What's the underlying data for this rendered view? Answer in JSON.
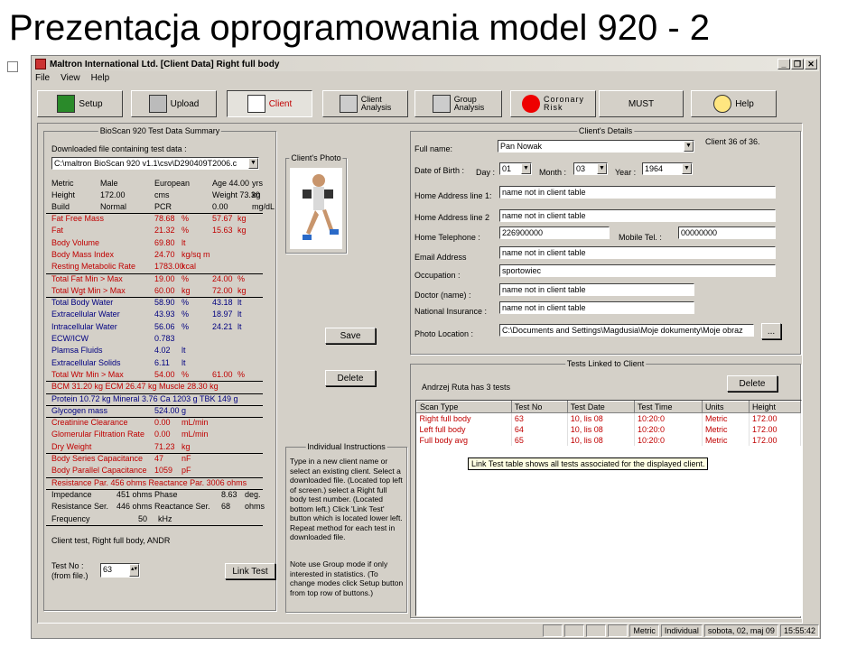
{
  "slide_title": "Prezentacja oprogramowania model 920 - 2",
  "window": {
    "title": "Maltron International Ltd.  [Client Data] Right full body",
    "btns": [
      "_",
      "❐",
      "✕"
    ]
  },
  "menu": [
    "File",
    "View",
    "Help"
  ],
  "toolbar": [
    {
      "label": "Setup",
      "icon": "setup-icon"
    },
    {
      "label": "Upload",
      "icon": "upload-icon"
    },
    {
      "label": "Client",
      "icon": "client-icon"
    },
    {
      "label": "Client\nAnalysis",
      "icon": "client-analysis-icon"
    },
    {
      "label": "Group\nAnalysis",
      "icon": "group-analysis-icon"
    },
    {
      "label": "Coronary\nRisk",
      "icon": "heart-icon"
    },
    {
      "label": "MUST",
      "icon": ""
    },
    {
      "label": "Help",
      "icon": "help-icon"
    }
  ],
  "bioscan": {
    "title": "BioScan 920 Test Data Summary",
    "downloaded_label": "Downloaded file containing  test data :",
    "file": "C:\\maltron BioScan 920 v1.1\\csv\\D290409T2006.c",
    "basic": [
      [
        "Metric",
        "Male",
        "European",
        "Age 44.00",
        "yrs"
      ],
      [
        "Height",
        "172.00",
        "cms",
        "Weight 73.30",
        "kg"
      ],
      [
        "Build",
        "Normal",
        "PCR",
        "0.00",
        "mg/dL"
      ]
    ],
    "rows": [
      [
        "Fat Free Mass",
        "78.68",
        "%",
        "57.67",
        "kg"
      ],
      [
        "Fat",
        "21.32",
        "%",
        "15.63",
        "kg"
      ],
      [
        "Body Volume",
        "69.80",
        "lt",
        "",
        ""
      ],
      [
        "Body Mass Index",
        "24.70",
        "kg/sq m",
        "",
        ""
      ],
      [
        "Resting Metabolic Rate",
        "1783.00",
        "kcal",
        "",
        ""
      ],
      [
        "Total Fat   Min > Max",
        "19.00",
        "%",
        "24.00",
        "%"
      ],
      [
        "Total Wgt   Min > Max",
        "60.00",
        "kg",
        "72.00",
        "kg"
      ],
      [
        "Total Body Water",
        "58.90",
        "%",
        "43.18",
        "lt"
      ],
      [
        "Extracellular Water",
        "43.93",
        "%",
        "18.97",
        "lt"
      ],
      [
        "Intracellular Water",
        "56.06",
        "%",
        "24.21",
        "lt"
      ],
      [
        "ECW/ICW",
        "0.783",
        "",
        "",
        ""
      ],
      [
        "Plamsa Fluids",
        "4.02",
        "lt",
        "",
        ""
      ],
      [
        "Extracellular Solids",
        "6.11",
        "lt",
        "",
        ""
      ],
      [
        "Total Wtr Min > Max",
        "54.00",
        "%",
        "61.00",
        "%"
      ]
    ],
    "bcm_line": "BCM    31.20  kg    ECM     26.47  kg    Muscle 28.30  kg",
    "protein_line": "Protein 10.72  kg    Mineral 3.76    Ca 1203 g    TBK 149    g",
    "rows2": [
      [
        "Glycogen mass",
        "524.00",
        "g"
      ],
      [
        "Creatinine Clearance",
        "0.00",
        "mL/min"
      ],
      [
        "Glomerular Filtration Rate",
        "0.00",
        "mL/min"
      ],
      [
        "Dry Weight",
        "71.23",
        "kg"
      ],
      [
        "Body Series Capacitance",
        "47",
        "nF"
      ],
      [
        "Body Parallel Capacitance",
        "1059",
        "pF"
      ]
    ],
    "resistance_line": "Resistance Par.     456 ohms Reactance Par. 3006    ohms",
    "rows3": [
      [
        "Impedance",
        "451 ohms Phase",
        "8.63",
        "deg."
      ],
      [
        "Resistance Ser.",
        "446 ohms Reactance Ser.",
        "68",
        "ohms"
      ],
      [
        "Frequency",
        "50",
        "kHz",
        ""
      ]
    ],
    "footer": "Client test, Right full body, ANDR",
    "test_no_label": "Test No :\n(from file.)",
    "test_no": "63",
    "link_test": "Link Test"
  },
  "photo": {
    "title": "Client's Photo"
  },
  "buttons": {
    "save": "Save",
    "delete": "Delete",
    "browse": "..."
  },
  "instructions": {
    "title": "Individual Instructions",
    "text": "Type in a new client name or select an existing client. Select a downloaded file. (Located top left of screen.) select a Right full body test number. (Located bottom left.) Click 'Link Test' button which is located lower left. Repeat method for each test in downloaded file.",
    "note": "Note use Group mode if only interested in statistics. (To change modes click Setup button from top row of buttons.)"
  },
  "details": {
    "title": "Client's Details",
    "counter": "Client 36 of 36.",
    "full_name_label": "Full name:",
    "full_name": "Pan Nowak",
    "dob_label": "Date of Birth :",
    "day_label": "Day :",
    "day": "01",
    "month_label": "Month :",
    "month": "03",
    "year_label": "Year :",
    "year": "1964",
    "addr1_label": "Home Address  line 1:",
    "addr1": "name not in client table",
    "addr2_label": "Home Address line 2",
    "addr2": "name not in client table",
    "tel_label": "Home Telephone :",
    "tel": "226900000",
    "mobile_label": "Mobile Tel. :",
    "mobile": "00000000",
    "email_label": "Email Address",
    "email": "name not in client table",
    "occ_label": "Occupation :",
    "occ": "sportowiec",
    "doctor_label": "Doctor (name) :",
    "doctor": "name not in client table",
    "ins_label": "National Insurance :",
    "ins": "name not in client table",
    "photo_loc_label": "Photo Location :",
    "photo_loc": "C:\\Documents and Settings\\Magdusia\\Moje dokumenty\\Moje obraz"
  },
  "tests": {
    "title": "Tests Linked to Client",
    "summary": "Andrzej Ruta has 3 tests",
    "delete": "Delete",
    "headers": [
      "Scan Type",
      "Test No",
      "Test Date",
      "Test Time",
      "Units",
      "Height"
    ],
    "rows": [
      [
        "Right full body",
        "63",
        "10, lis 08",
        "10:20:0",
        "Metric",
        "172.00"
      ],
      [
        "Left full body",
        "64",
        "10, lis 08",
        "10:20:0",
        "Metric",
        "172.00"
      ],
      [
        "Full body avg",
        "65",
        "10, lis 08",
        "10:20:0",
        "Metric",
        "172.00"
      ]
    ],
    "tooltip": "Link Test table shows all tests associated for the displayed client."
  },
  "status": [
    "Metric",
    "Individual",
    "sobota, 02, maj 09",
    "15:55:42"
  ]
}
